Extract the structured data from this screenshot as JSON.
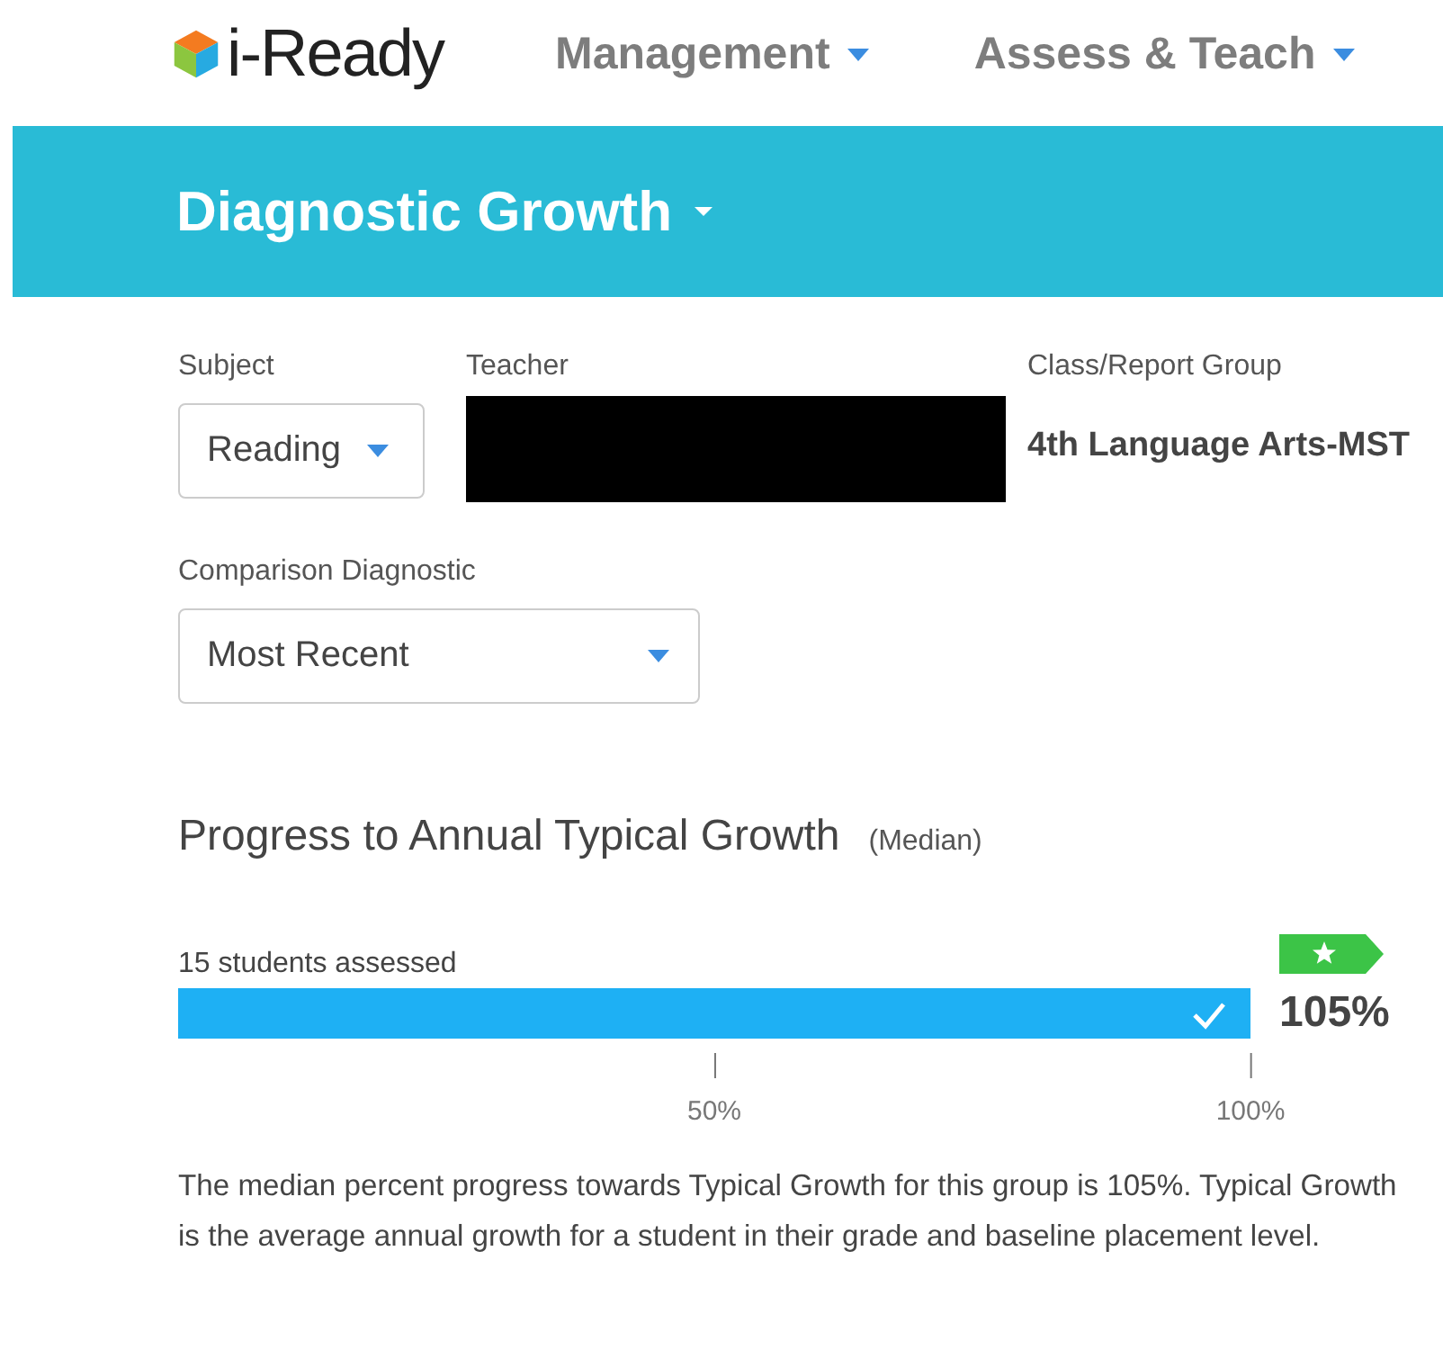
{
  "header": {
    "logo": "i-Ready",
    "nav": [
      {
        "label": "Management"
      },
      {
        "label": "Assess & Teach"
      }
    ]
  },
  "banner": {
    "title": "Diagnostic Growth"
  },
  "filters": {
    "subject": {
      "label": "Subject",
      "value": "Reading"
    },
    "teacher": {
      "label": "Teacher",
      "redacted": true
    },
    "class_group": {
      "label": "Class/Report Group",
      "value": "4th Language Arts-MST"
    },
    "comparison": {
      "label": "Comparison Diagnostic",
      "value": "Most Recent"
    }
  },
  "progress": {
    "title": "Progress to Annual Typical Growth",
    "qualifier": "(Median)",
    "count": "15 students assessed",
    "level": 1,
    "met": true,
    "value": "105%",
    "ticks": [
      {
        "label": "50%"
      },
      {
        "label": "100%"
      }
    ],
    "description": "The median percent progress towards Typical Growth for this group is 105%. Typical Growth is the average annual growth for a student in their grade and baseline placement level."
  }
}
